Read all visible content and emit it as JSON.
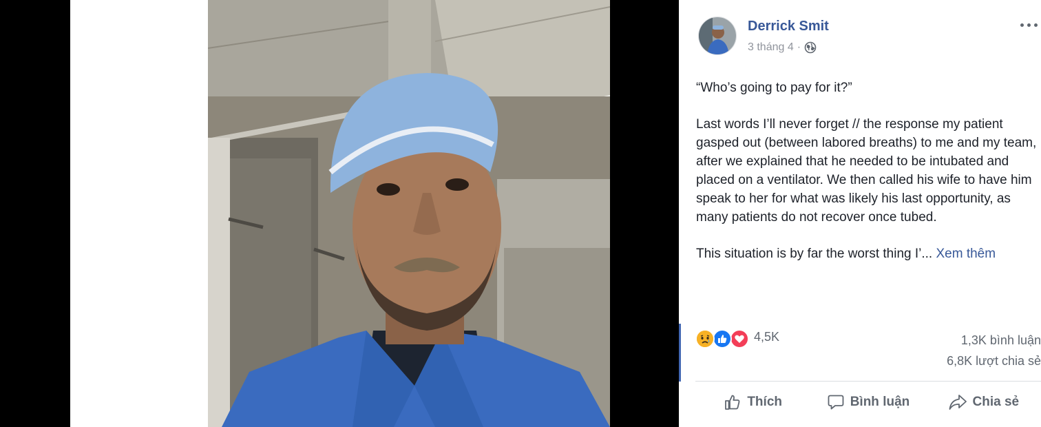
{
  "post": {
    "author": "Derrick Smit",
    "date": "3 tháng 4",
    "separator": "·",
    "paragraphs": [
      "“Who’s going to pay for it?”",
      "Last words I’ll never forget // the response my patient gasped out (between labored breaths) to me and my team, after we explained that he needed to be intubated and placed on a ventilator. We then called his wife to have him speak to her for what was likely his last opportunity, as many patients do not recover once tubed."
    ],
    "truncated_text": "This situation is by far the worst thing I’...",
    "see_more": "Xem thêm"
  },
  "engagement": {
    "reaction_count": "4,5K",
    "reactions": [
      "sad-reaction-icon",
      "like-reaction-icon",
      "love-reaction-icon"
    ],
    "comments": "1,3K bình luận",
    "shares": "6,8K lượt chia sẻ"
  },
  "actions": {
    "like": "Thích",
    "comment": "Bình luận",
    "share": "Chia sẻ"
  },
  "colors": {
    "link": "#385898",
    "like_blue": "#1877f2",
    "love_red": "#f33e58",
    "sad_yellow": "#f7b125",
    "meta_gray": "#90949c"
  }
}
